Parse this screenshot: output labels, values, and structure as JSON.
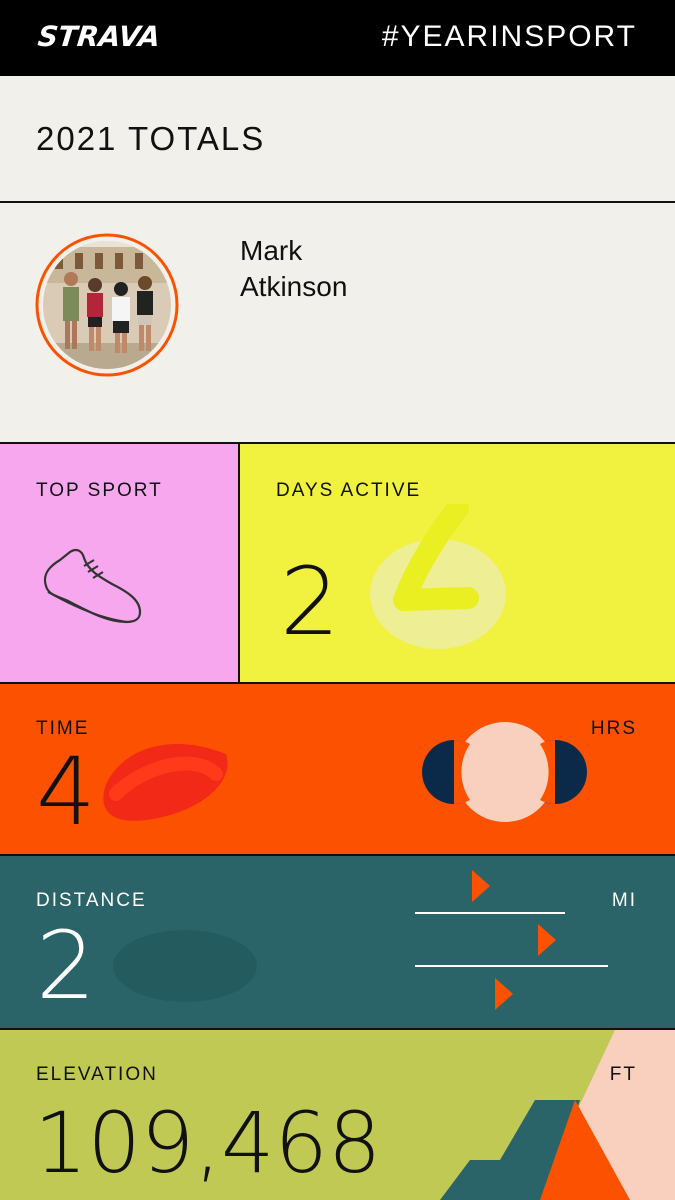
{
  "header": {
    "logo": "STRAVA",
    "hashtag": "#YEARINSPORT"
  },
  "totals": {
    "title": "2021 TOTALS"
  },
  "profile": {
    "first_name": "Mark",
    "last_name": "Atkinson"
  },
  "top_sport": {
    "label": "TOP SPORT",
    "icon": "running-shoe-icon"
  },
  "days_active": {
    "label": "DAYS ACTIVE",
    "value": "2"
  },
  "time": {
    "label": "TIME",
    "unit": "HRS",
    "value": "4"
  },
  "distance": {
    "label": "DISTANCE",
    "unit": "MI",
    "value": "2"
  },
  "elevation": {
    "label": "ELEVATION",
    "unit": "FT",
    "value": "109,468"
  },
  "colors": {
    "brand_orange": "#fc5200",
    "pink": "#f6a7ee",
    "yellow": "#f0f23f",
    "teal": "#2a6468",
    "olive": "#c0c954",
    "navy": "#0b2a4a",
    "peach": "#f9d0bd"
  }
}
